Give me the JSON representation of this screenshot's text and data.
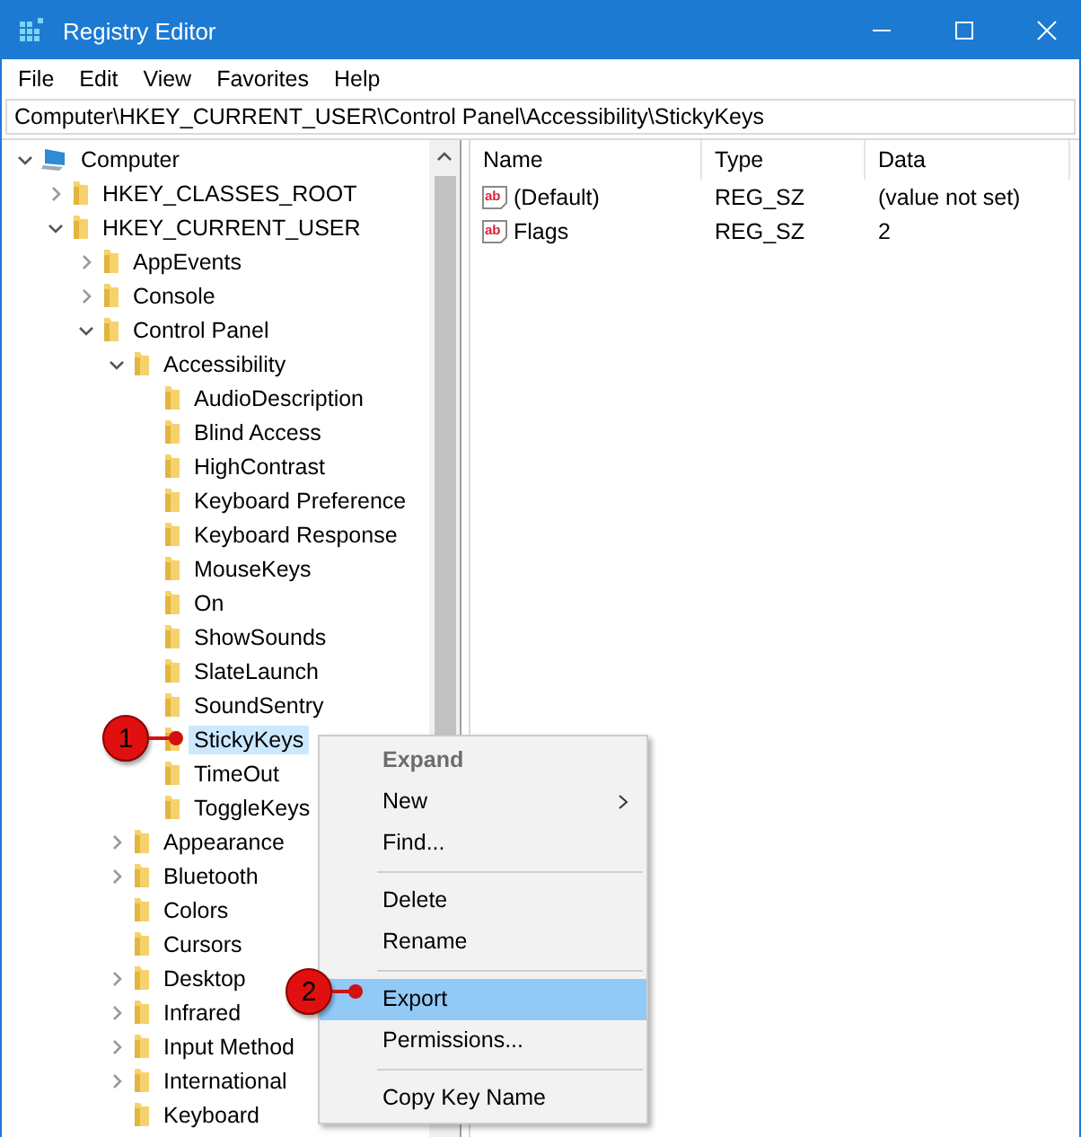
{
  "window": {
    "title": "Registry Editor"
  },
  "menu": [
    "File",
    "Edit",
    "View",
    "Favorites",
    "Help"
  ],
  "address": "Computer\\HKEY_CURRENT_USER\\Control Panel\\Accessibility\\StickyKeys",
  "tree": [
    {
      "label": "Computer",
      "kind": "computer",
      "expanded": true,
      "selected": false,
      "children": [
        {
          "label": "HKEY_CLASSES_ROOT",
          "kind": "folder",
          "expanded": false,
          "selected": false
        },
        {
          "label": "HKEY_CURRENT_USER",
          "kind": "folder",
          "expanded": true,
          "selected": false,
          "children": [
            {
              "label": "AppEvents",
              "kind": "folder",
              "expanded": false,
              "selected": false
            },
            {
              "label": "Console",
              "kind": "folder",
              "expanded": false,
              "selected": false
            },
            {
              "label": "Control Panel",
              "kind": "folder",
              "expanded": true,
              "selected": false,
              "children": [
                {
                  "label": "Accessibility",
                  "kind": "folder",
                  "expanded": true,
                  "selected": false,
                  "children": [
                    {
                      "label": "AudioDescription",
                      "kind": "folder",
                      "selected": false
                    },
                    {
                      "label": "Blind Access",
                      "kind": "folder",
                      "selected": false
                    },
                    {
                      "label": "HighContrast",
                      "kind": "folder",
                      "selected": false
                    },
                    {
                      "label": "Keyboard Preference",
                      "kind": "folder",
                      "selected": false
                    },
                    {
                      "label": "Keyboard Response",
                      "kind": "folder",
                      "selected": false
                    },
                    {
                      "label": "MouseKeys",
                      "kind": "folder",
                      "selected": false
                    },
                    {
                      "label": "On",
                      "kind": "folder",
                      "selected": false
                    },
                    {
                      "label": "ShowSounds",
                      "kind": "folder",
                      "selected": false
                    },
                    {
                      "label": "SlateLaunch",
                      "kind": "folder",
                      "selected": false
                    },
                    {
                      "label": "SoundSentry",
                      "kind": "folder",
                      "selected": false
                    },
                    {
                      "label": "StickyKeys",
                      "kind": "folder",
                      "selected": true
                    },
                    {
                      "label": "TimeOut",
                      "kind": "folder",
                      "selected": false
                    },
                    {
                      "label": "ToggleKeys",
                      "kind": "folder",
                      "selected": false
                    }
                  ]
                },
                {
                  "label": "Appearance",
                  "kind": "folder",
                  "expanded": false,
                  "selected": false
                },
                {
                  "label": "Bluetooth",
                  "kind": "folder",
                  "expanded": false,
                  "selected": false
                },
                {
                  "label": "Colors",
                  "kind": "folder",
                  "selected": false
                },
                {
                  "label": "Cursors",
                  "kind": "folder",
                  "selected": false
                },
                {
                  "label": "Desktop",
                  "kind": "folder",
                  "expanded": false,
                  "selected": false
                },
                {
                  "label": "Infrared",
                  "kind": "folder",
                  "expanded": false,
                  "selected": false
                },
                {
                  "label": "Input Method",
                  "kind": "folder",
                  "expanded": false,
                  "selected": false
                },
                {
                  "label": "International",
                  "kind": "folder",
                  "expanded": false,
                  "selected": false
                },
                {
                  "label": "Keyboard",
                  "kind": "folder",
                  "selected": false
                }
              ]
            }
          ]
        }
      ]
    }
  ],
  "values": {
    "columns": [
      "Name",
      "Type",
      "Data"
    ],
    "rows": [
      {
        "icon_text": "ab",
        "name": "(Default)",
        "type": "REG_SZ",
        "data": "(value not set)"
      },
      {
        "icon_text": "ab",
        "name": "Flags",
        "type": "REG_SZ",
        "data": "2"
      }
    ]
  },
  "context_menu": {
    "items": [
      {
        "kind": "item",
        "label": "Expand",
        "default": true,
        "disabled": true,
        "selected": false,
        "submenu": false
      },
      {
        "kind": "item",
        "label": "New",
        "default": false,
        "disabled": false,
        "selected": false,
        "submenu": true
      },
      {
        "kind": "item",
        "label": "Find...",
        "default": false,
        "disabled": false,
        "selected": false,
        "submenu": false
      },
      {
        "kind": "separator"
      },
      {
        "kind": "item",
        "label": "Delete",
        "default": false,
        "disabled": false,
        "selected": false,
        "submenu": false
      },
      {
        "kind": "item",
        "label": "Rename",
        "default": false,
        "disabled": false,
        "selected": false,
        "submenu": false
      },
      {
        "kind": "separator"
      },
      {
        "kind": "item",
        "label": "Export",
        "default": false,
        "disabled": false,
        "selected": true,
        "submenu": false
      },
      {
        "kind": "item",
        "label": "Permissions...",
        "default": false,
        "disabled": false,
        "selected": false,
        "submenu": false
      },
      {
        "kind": "separator"
      },
      {
        "kind": "item",
        "label": "Copy Key Name",
        "default": false,
        "disabled": false,
        "selected": false,
        "submenu": false
      }
    ]
  },
  "callouts": [
    {
      "number": "1"
    },
    {
      "number": "2"
    }
  ]
}
